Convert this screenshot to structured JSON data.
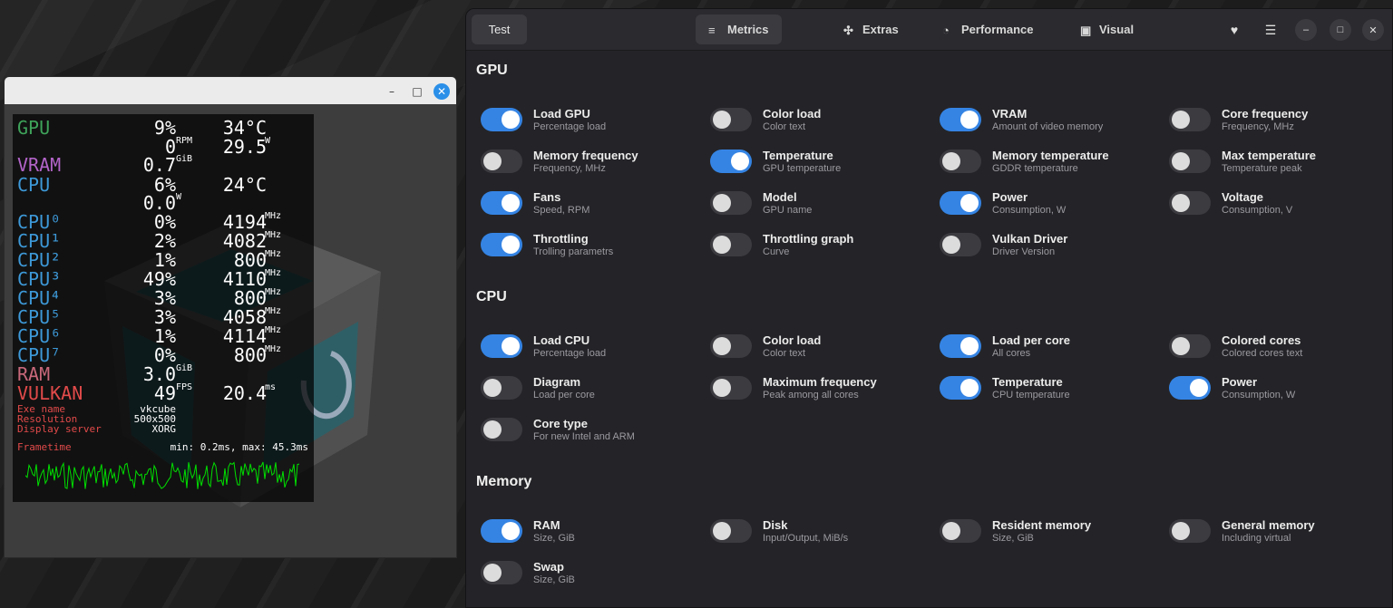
{
  "vkcube_window": {
    "controls": {
      "minimize": "–",
      "maximize": "□",
      "close": "✕"
    },
    "overlay": {
      "rows": [
        {
          "label": "GPU",
          "class": "c-gpu",
          "v1": "9%",
          "u1": "",
          "v2": "34°C",
          "u2": ""
        },
        {
          "label": "",
          "class": "c-gpu",
          "v1": "0",
          "u1": "RPM",
          "v2": "29.5",
          "u2": "W"
        },
        {
          "label": "VRAM",
          "class": "c-vram",
          "v1": "0.7",
          "u1": "GiB",
          "v2": "",
          "u2": ""
        },
        {
          "label": "CPU",
          "class": "c-cpu",
          "v1": "6%",
          "u1": "",
          "v2": "24°C",
          "u2": ""
        },
        {
          "label": "",
          "class": "c-cpu",
          "v1": "0.0",
          "u1": "W",
          "v2": "",
          "u2": ""
        },
        {
          "label": "CPU⁰",
          "class": "c-cpu",
          "v1": "0%",
          "u1": "",
          "v2": "4194",
          "u2": "MHz"
        },
        {
          "label": "CPU¹",
          "class": "c-cpu",
          "v1": "2%",
          "u1": "",
          "v2": "4082",
          "u2": "MHz"
        },
        {
          "label": "CPU²",
          "class": "c-cpu",
          "v1": "1%",
          "u1": "",
          "v2": "800",
          "u2": "MHz"
        },
        {
          "label": "CPU³",
          "class": "c-cpu",
          "v1": "49%",
          "u1": "",
          "v2": "4110",
          "u2": "MHz"
        },
        {
          "label": "CPU⁴",
          "class": "c-cpu",
          "v1": "3%",
          "u1": "",
          "v2": "800",
          "u2": "MHz"
        },
        {
          "label": "CPU⁵",
          "class": "c-cpu",
          "v1": "3%",
          "u1": "",
          "v2": "4058",
          "u2": "MHz"
        },
        {
          "label": "CPU⁶",
          "class": "c-cpu",
          "v1": "1%",
          "u1": "",
          "v2": "4114",
          "u2": "MHz"
        },
        {
          "label": "CPU⁷",
          "class": "c-cpu",
          "v1": "0%",
          "u1": "",
          "v2": "800",
          "u2": "MHz"
        },
        {
          "label": "RAM",
          "class": "c-ram",
          "v1": "3.0",
          "u1": "GiB",
          "v2": "",
          "u2": ""
        },
        {
          "label": "VULKAN",
          "class": "c-vk",
          "v1": "49",
          "u1": "FPS",
          "v2": "20.4",
          "u2": "ms"
        }
      ],
      "info": [
        {
          "label": "Exe name",
          "value": "vkcube"
        },
        {
          "label": "Resolution",
          "value": "500x500"
        },
        {
          "label": "Display server",
          "value": "XORG"
        }
      ],
      "frametime_label": "Frametime",
      "frametime_minmax": "min: 0.2ms, max: 45.3ms",
      "graph_color": "#00e000"
    }
  },
  "app": {
    "test_button": "Test",
    "tabs": [
      {
        "label": "Metrics",
        "icon": "metrics-icon",
        "active": true
      },
      {
        "label": "Extras",
        "icon": "puzzle-icon",
        "active": false
      },
      {
        "label": "Performance",
        "icon": "speedometer-icon",
        "active": false
      },
      {
        "label": "Visual",
        "icon": "image-icon",
        "active": false
      }
    ],
    "header_icons": [
      "heart-icon",
      "menu-icon"
    ],
    "window_controls": {
      "minimize": "–",
      "maximize": "□",
      "close": "✕"
    },
    "accent_color": "#3584e4",
    "sections": [
      {
        "title": "GPU",
        "options": [
          {
            "title": "Load GPU",
            "subtitle": "Percentage load",
            "on": true
          },
          {
            "title": "Color load",
            "subtitle": "Color text",
            "on": false
          },
          {
            "title": "VRAM",
            "subtitle": "Amount of video memory",
            "on": true
          },
          {
            "title": "Core frequency",
            "subtitle": "Frequency, MHz",
            "on": false
          },
          {
            "title": "Memory frequency",
            "subtitle": "Frequency, MHz",
            "on": false
          },
          {
            "title": "Temperature",
            "subtitle": "GPU temperature",
            "on": true
          },
          {
            "title": "Memory temperature",
            "subtitle": "GDDR temperature",
            "on": false
          },
          {
            "title": "Max temperature",
            "subtitle": "Temperature peak",
            "on": false
          },
          {
            "title": "Fans",
            "subtitle": "Speed, RPM",
            "on": true
          },
          {
            "title": "Model",
            "subtitle": "GPU name",
            "on": false
          },
          {
            "title": "Power",
            "subtitle": "Consumption, W",
            "on": true
          },
          {
            "title": "Voltage",
            "subtitle": "Consumption, V",
            "on": false
          },
          {
            "title": "Throttling",
            "subtitle": "Trolling parametrs",
            "on": true
          },
          {
            "title": "Throttling graph",
            "subtitle": "Curve",
            "on": false
          },
          {
            "title": "Vulkan Driver",
            "subtitle": "Driver Version",
            "on": false
          }
        ]
      },
      {
        "title": "CPU",
        "options": [
          {
            "title": "Load CPU",
            "subtitle": "Percentage load",
            "on": true
          },
          {
            "title": "Color load",
            "subtitle": "Color text",
            "on": false
          },
          {
            "title": "Load per core",
            "subtitle": "All cores",
            "on": true
          },
          {
            "title": "Colored cores",
            "subtitle": "Colored cores text",
            "on": false
          },
          {
            "title": "Diagram",
            "subtitle": "Load per core",
            "on": false
          },
          {
            "title": "Maximum frequency",
            "subtitle": "Peak among all cores",
            "on": false
          },
          {
            "title": "Temperature",
            "subtitle": "CPU temperature",
            "on": true
          },
          {
            "title": "Power",
            "subtitle": "Consumption, W",
            "on": true
          },
          {
            "title": "Core type",
            "subtitle": "For new Intel and ARM",
            "on": false
          }
        ]
      },
      {
        "title": "Memory",
        "options": [
          {
            "title": "RAM",
            "subtitle": "Size, GiB",
            "on": true
          },
          {
            "title": "Disk",
            "subtitle": "Input/Output, MiB/s",
            "on": false
          },
          {
            "title": "Resident memory",
            "subtitle": "Size, GiB",
            "on": false
          },
          {
            "title": "General memory",
            "subtitle": "Including virtual",
            "on": false
          },
          {
            "title": "Swap",
            "subtitle": "Size, GiB",
            "on": false
          }
        ]
      }
    ]
  }
}
